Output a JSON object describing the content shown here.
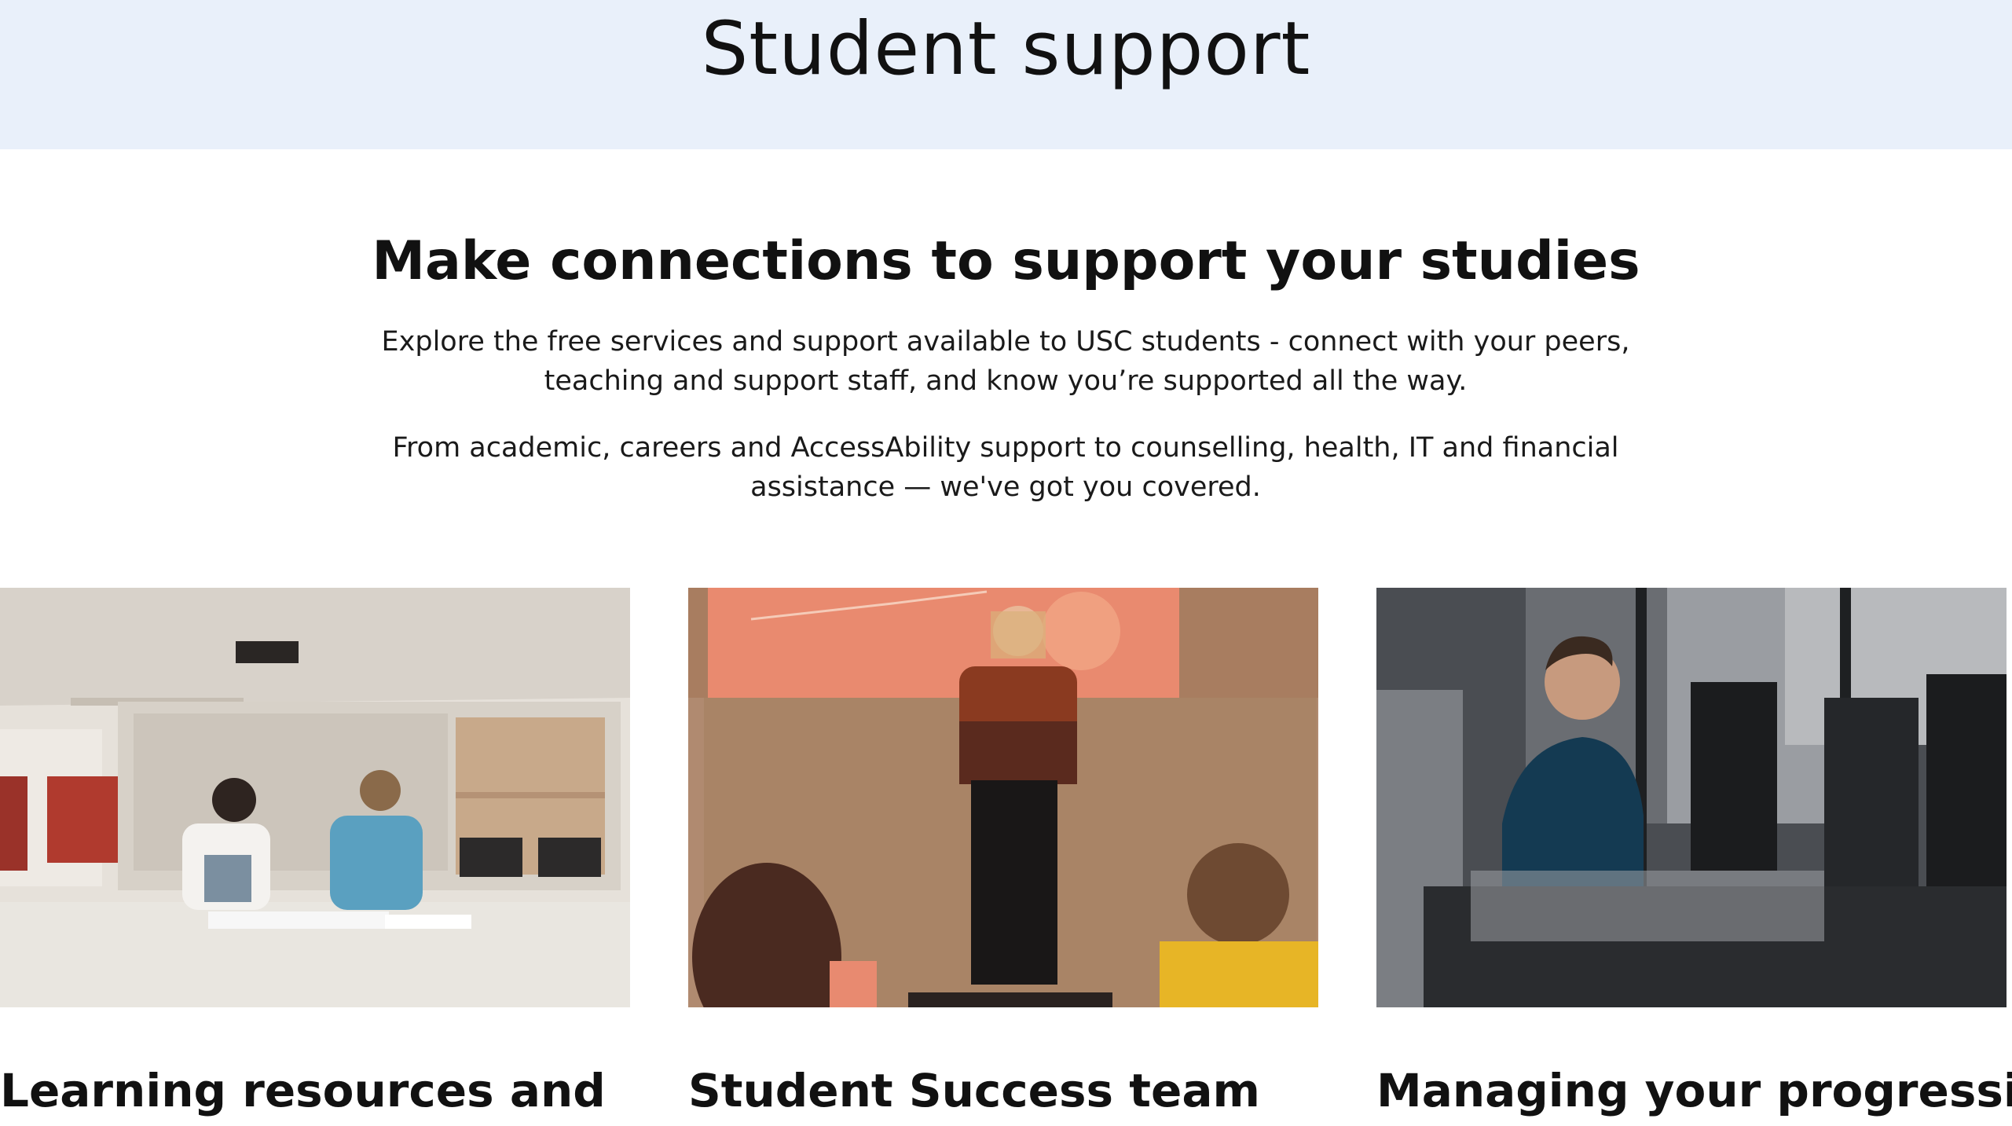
{
  "hero": {
    "title": "Student support",
    "background": "#e9f0fa"
  },
  "intro": {
    "heading": "Make connections to support your studies",
    "paragraph_1_line_1": "Explore the free services and support available to USC students - connect with your peers,",
    "paragraph_1_line_2": "teaching and support staff, and know you’re supported all the way.",
    "paragraph_2_line_1": "From academic, careers and AccessAbility support to counselling, health, IT and financial",
    "paragraph_2_line_2": "assistance — we've got you covered."
  },
  "cards": [
    {
      "title": "Learning resources and",
      "image_icon": "photo-two-students-studying"
    },
    {
      "title": "Student Success team",
      "image_icon": "photo-presenter-in-classroom"
    },
    {
      "title": "Managing your progression",
      "image_icon": "photo-student-at-computer-lab"
    }
  ]
}
